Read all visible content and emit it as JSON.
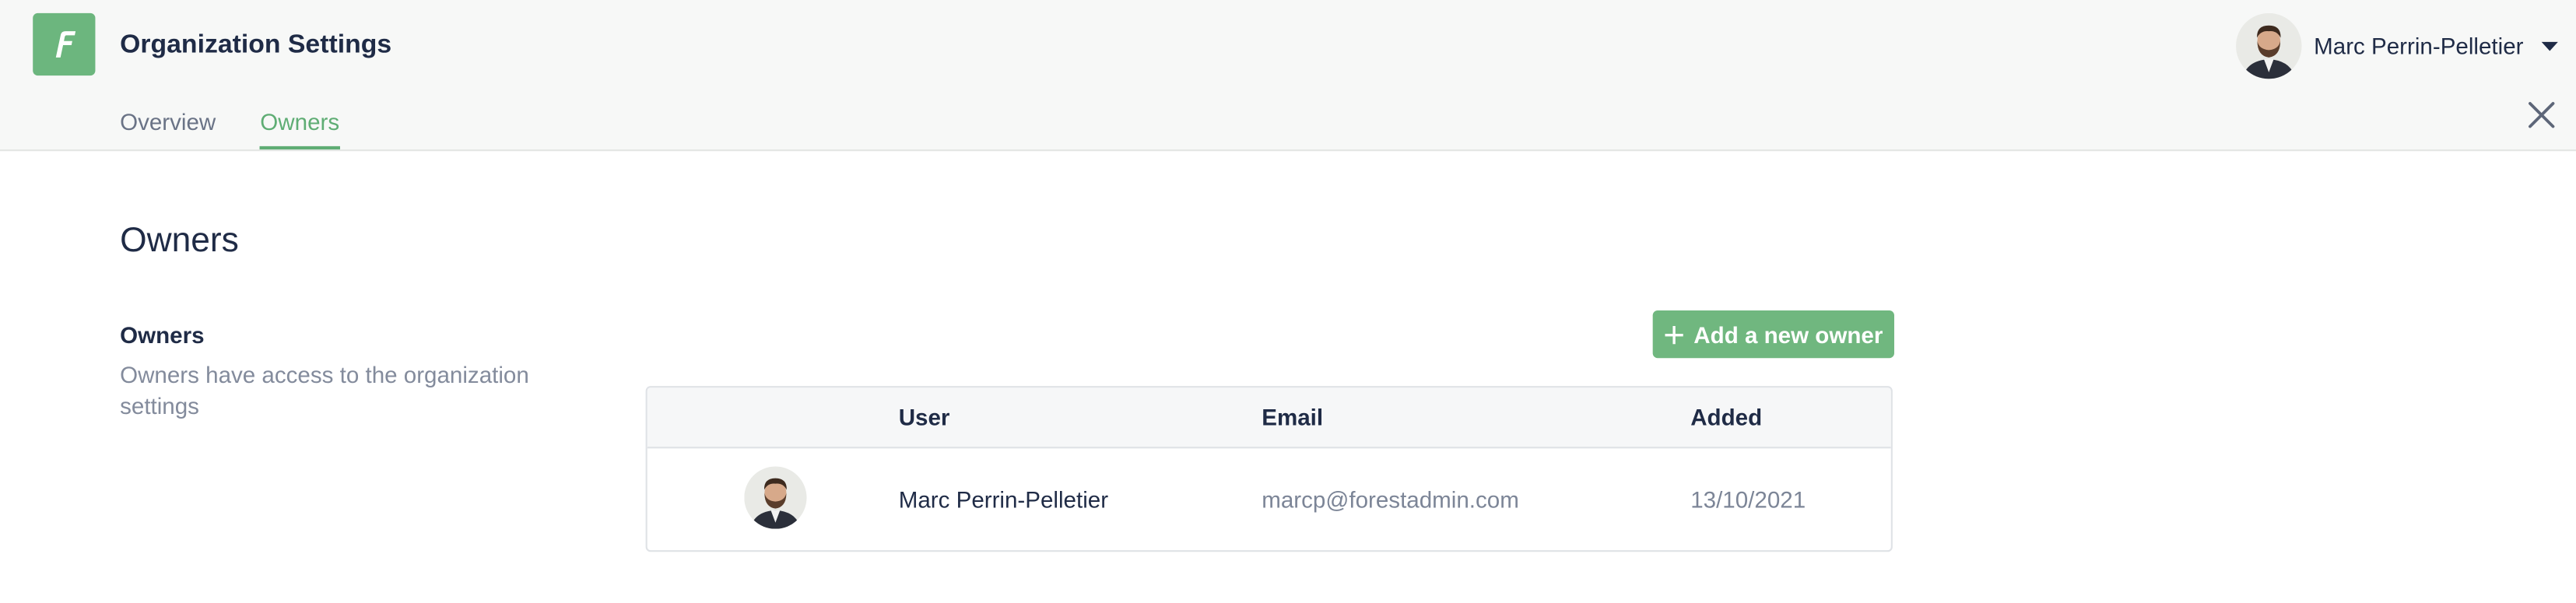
{
  "header": {
    "title": "Organization Settings",
    "logo_icon": "forest-f-logo-icon",
    "brand_color": "#6cb67e"
  },
  "tabs": [
    {
      "label": "Overview",
      "active": false
    },
    {
      "label": "Owners",
      "active": true
    }
  ],
  "user_menu": {
    "name": "Marc Perrin-Pelletier",
    "avatar_icon": "user-avatar",
    "chevron_icon": "chevron-down-icon"
  },
  "close_icon": "close-icon",
  "page": {
    "title": "Owners"
  },
  "section": {
    "title": "Owners",
    "description": "Owners have access to the organization settings"
  },
  "actions": {
    "add_owner_label": "Add a new owner",
    "add_icon": "plus-icon",
    "accent_color": "#70b77f"
  },
  "table": {
    "columns": [
      "User",
      "Email",
      "Added"
    ],
    "rows": [
      {
        "user": "Marc Perrin-Pelletier",
        "email": "marcp@forestadmin.com",
        "added": "13/10/2021"
      }
    ]
  }
}
